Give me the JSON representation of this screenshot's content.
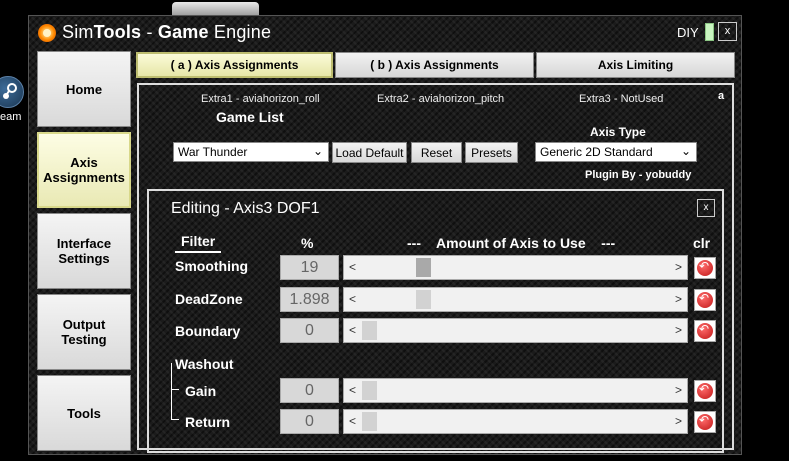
{
  "desktop": {
    "icon_label": "eam"
  },
  "window": {
    "title_light_1": "Sim",
    "title_bold_1": "Tools",
    "title_sep": " - ",
    "title_bold_2": "Game",
    "title_light_2": " Engine",
    "diy_label": "DIY",
    "close_label": "x"
  },
  "nav": [
    {
      "label": "Home"
    },
    {
      "label": "Axis\nAssignments"
    },
    {
      "label": "Interface\nSettings"
    },
    {
      "label": "Output\nTesting"
    },
    {
      "label": "Tools"
    }
  ],
  "tabs": [
    {
      "label": "( a ) Axis Assignments"
    },
    {
      "label": "( b ) Axis Assignments"
    },
    {
      "label": "Axis Limiting"
    }
  ],
  "extras": {
    "extra1": "Extra1 - aviahorizon_roll",
    "extra2": "Extra2 - aviahorizon_pitch",
    "extra3": "Extra3 - NotUsed",
    "corner": "a"
  },
  "game": {
    "label": "Game List",
    "selected": "War Thunder",
    "load_default": "Load Default",
    "reset": "Reset",
    "presets": "Presets"
  },
  "axis_type": {
    "label": "Axis Type",
    "selected": "Generic 2D Standard"
  },
  "plugin_by": "Plugin By - yobuddy",
  "editor": {
    "title": "Editing - Axis3 DOF1",
    "close_label": "x",
    "filter_header": "Filter",
    "percent_header": "%",
    "amount_header": "---    Amount of Axis to Use    ---",
    "clr_header": "clr",
    "washout_label": "Washout",
    "rows": [
      {
        "label": "Smoothing",
        "value": "19",
        "level": 0.19
      },
      {
        "label": "DeadZone",
        "value": "1.898",
        "level": 0.19
      },
      {
        "label": "Boundary",
        "value": "0",
        "level": 0
      },
      {
        "label": "Gain",
        "value": "0",
        "level": 0
      },
      {
        "label": "Return",
        "value": "0",
        "level": 0
      }
    ],
    "arrow_left": "<",
    "arrow_right": ">"
  },
  "colors": {
    "active_nav": "#fdfde4",
    "thumb_dark": "#a9a9a9",
    "thumb_light": "#d2d2d2",
    "clr_red": "#d42020"
  }
}
